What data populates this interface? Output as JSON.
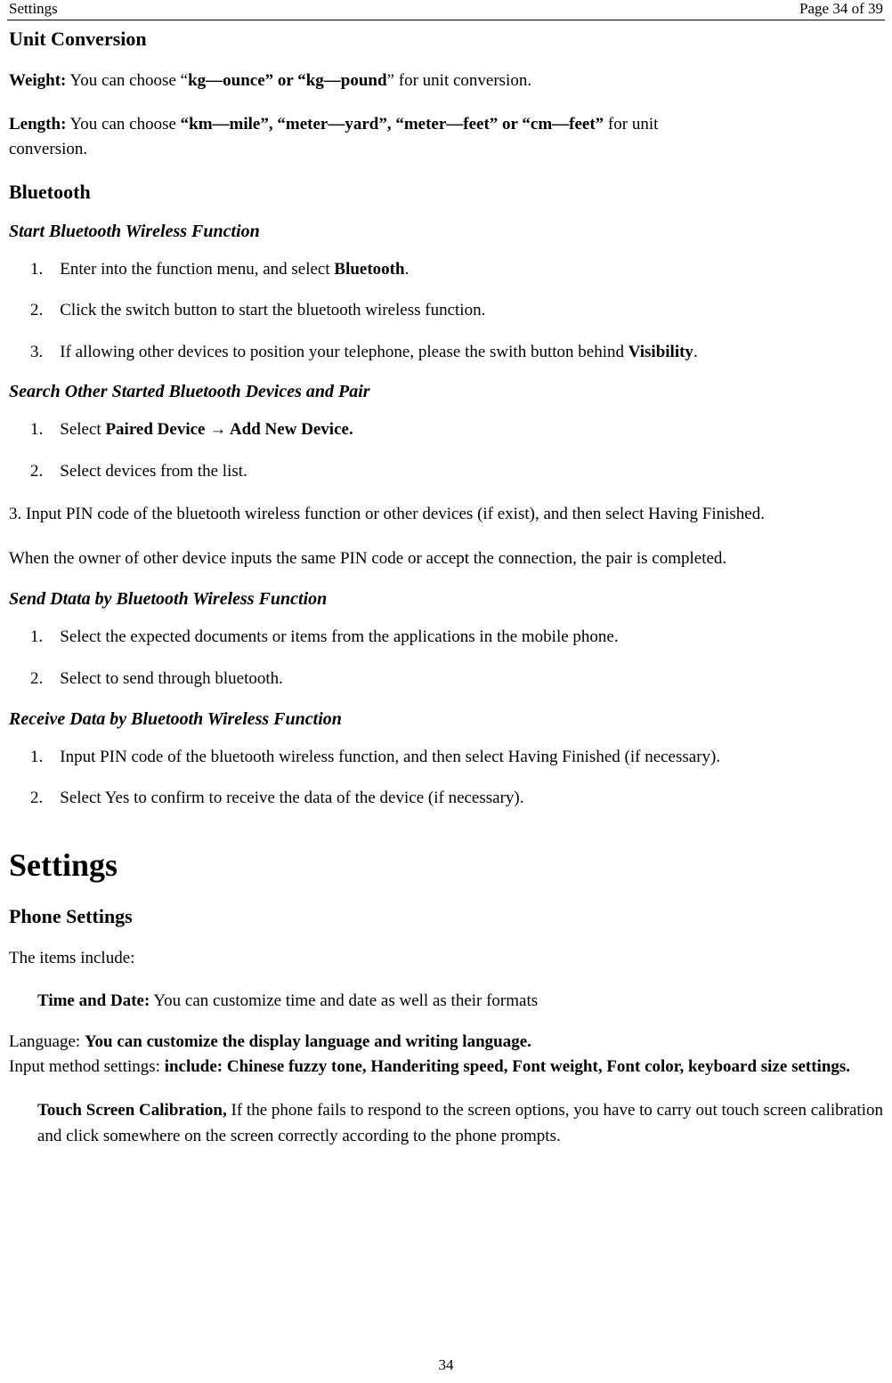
{
  "header": {
    "left": "Settings",
    "right": "Page 34 of 39"
  },
  "unit_conversion": {
    "heading": "Unit Conversion",
    "weight_label": "Weight:",
    "weight_pre": " You can choose “",
    "weight_bold": "kg—ounce” or “kg—pound",
    "weight_post": "” for unit conversion.",
    "length_label": "Length:",
    "length_mid": "   You  can  choose  ",
    "length_bold": "“km—mile”,  “meter—yard”,  “meter—feet”  or  “cm—feet”",
    "length_post_line1": "  for  unit",
    "length_post_line2": "conversion."
  },
  "bluetooth": {
    "heading": "Bluetooth",
    "start_heading": "Start Bluetooth Wireless Function",
    "start1_n": "1.",
    "start1_pre": "Enter into the function menu, and select ",
    "start1_bold": "Bluetooth",
    "start1_post": ".",
    "start2_n": "2.",
    "start2": "Click the switch button to start the bluetooth wireless function.",
    "start3_n": "3.",
    "start3_pre": "If allowing other devices to position your telephone, please the swith button behind ",
    "start3_bold": "Visibility",
    "start3_post": ".",
    "search_heading": "Search Other Started Bluetooth Devices and Pair",
    "search1_n": "1.",
    "search1_pre": "Select ",
    "search1_bold": "Paired Device → Add New Device.",
    "search2_n": "2.",
    "search2": "Select devices from the list.",
    "search3_text": "3.    Input PIN code of the bluetooth wireless function or other devices (if exist), and then select Having Finished.",
    "search_note": "When the owner of other device inputs the same PIN code or accept the connection, the pair is completed.",
    "send_heading": "Send Dtata by Bluetooth Wireless Function",
    "send1_n": "1.",
    "send1": "Select the expected documents or items from the applications in the mobile phone.",
    "send2_n": "2.",
    "send2": "Select to send through bluetooth.",
    "receive_heading": "Receive Data by Bluetooth Wireless Function",
    "receive1_n": "1.",
    "receive1": "Input PIN code of the bluetooth wireless function, and then select Having Finished (if necessary).",
    "receive2_n": "2.",
    "receive2": "Select Yes to confirm to receive the data of the device (if necessary)."
  },
  "settings": {
    "heading": "Settings",
    "phone_heading": "Phone Settings",
    "items_include": "The items include:",
    "time_label": "Time and Date:",
    "time_text": " You can customize time and date as well as their formats",
    "lang_pre": "Language: ",
    "lang_bold": "You can customize the display language and writing language.",
    "input_pre": "Input  method  settings:  ",
    "input_bold": "include:  Chinese  fuzzy  tone,  Handeriting  speed,  Font  weight,  Font  color, keyboard size settings.",
    "touch_label": "Touch Screen Calibration,",
    "touch_text": " If the phone fails to respond to the screen options, you have to carry out touch screen calibration and click somewhere on the screen correctly according to the phone prompts."
  },
  "footer": {
    "page": "34"
  }
}
